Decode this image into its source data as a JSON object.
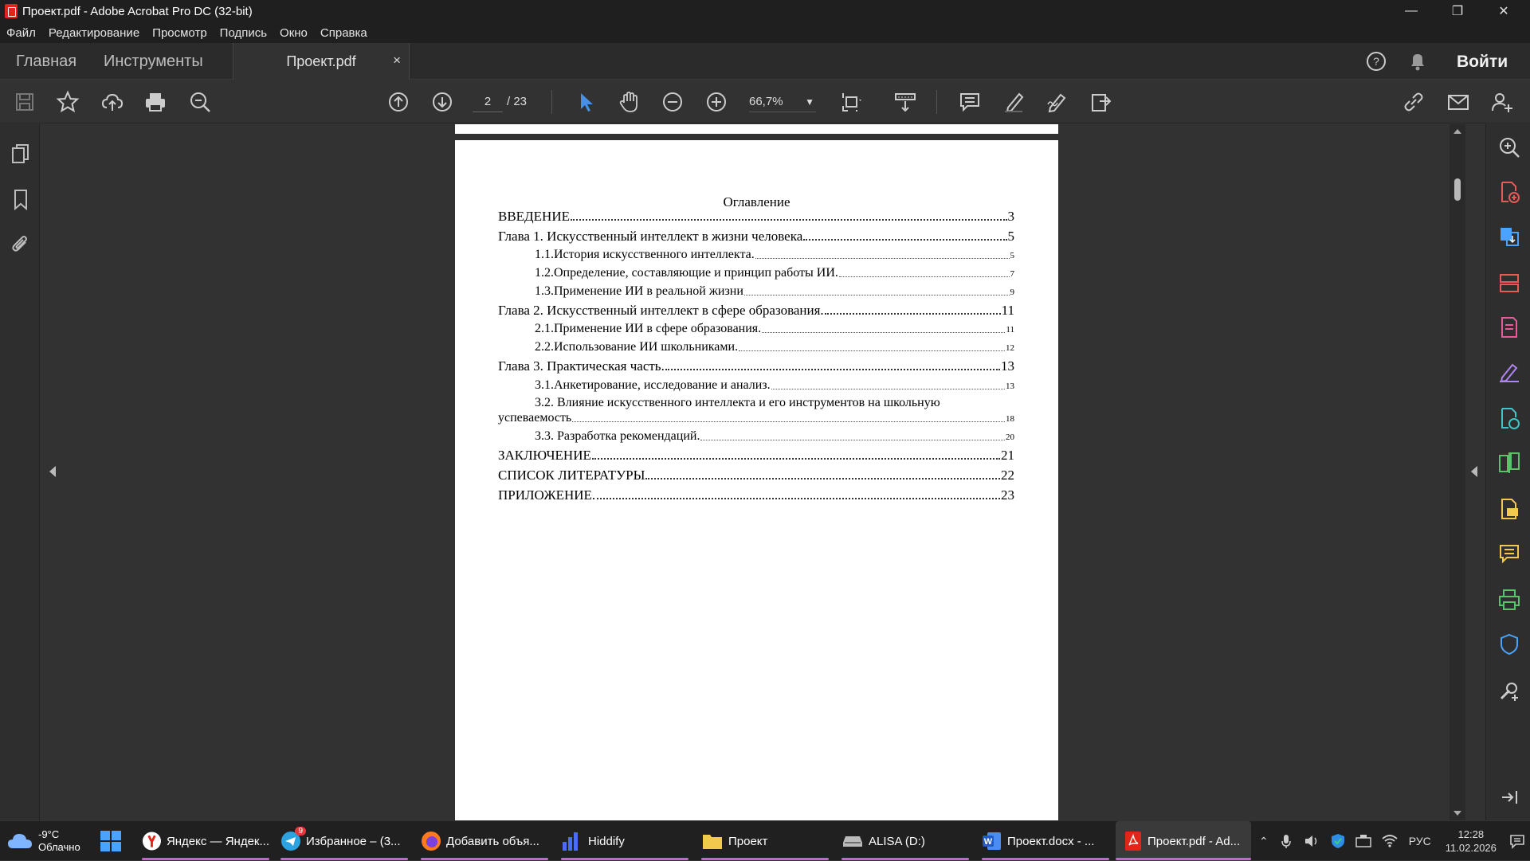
{
  "window": {
    "title": "Проект.pdf - Adobe Acrobat Pro DC (32-bit)"
  },
  "menu": {
    "items": [
      "Файл",
      "Редактирование",
      "Просмотр",
      "Подпись",
      "Окно",
      "Справка"
    ]
  },
  "tabs": {
    "home": "Главная",
    "tools": "Инструменты",
    "doc": "Проект.pdf",
    "close": "×",
    "login": "Войти"
  },
  "toolbar": {
    "page_current": "2",
    "page_total": "/ 23",
    "zoom": "66,7%"
  },
  "toc": {
    "title": "Оглавление",
    "rows": [
      {
        "text": "ВВЕДЕНИЕ",
        "page": "3"
      },
      {
        "text": "Глава 1. Искусственный интеллект в жизни человека",
        "page": "5"
      },
      {
        "text": "1.1.История искусственного интеллекта.",
        "page": "5"
      },
      {
        "text": "1.2.Определение, составляющие и принцип работы ИИ.",
        "page": "7"
      },
      {
        "text": "1.3.Применение ИИ в реальной жизни",
        "page": "9"
      },
      {
        "text": "Глава 2. Искусственный интеллект в сфере образования.",
        "page": "11"
      },
      {
        "text": "2.1.Применение ИИ в сфере образования.",
        "page": "11"
      },
      {
        "text": "2.2.Использование ИИ школьниками.",
        "page": "12"
      },
      {
        "text": "Глава 3. Практическая часть.",
        "page": "13"
      },
      {
        "text": "3.1.Анкетирование, исследование и анализ.",
        "page": "13"
      },
      {
        "text": "3.2. Влияние искусственного интеллекта и его инструментов на школьную",
        "page": ""
      },
      {
        "text": "успеваемость",
        "page": "18"
      },
      {
        "text": "3.3. Разработка рекомендаций.",
        "page": "20"
      },
      {
        "text": "ЗАКЛЮЧЕНИЕ",
        "page": "21"
      },
      {
        "text": "СПИСОК ЛИТЕРАТУРЫ",
        "page": "22"
      },
      {
        "text": "ПРИЛОЖЕНИЕ",
        "page": "23"
      }
    ]
  },
  "taskbar": {
    "weather_temp": "-9°C",
    "weather_desc": "Облачно",
    "apps": [
      {
        "label": "Яндекс — Яндек..."
      },
      {
        "label": "Избранное – (3..."
      },
      {
        "label": "Добавить объя..."
      },
      {
        "label": "Hiddify"
      },
      {
        "label": "Проект"
      },
      {
        "label": "ALISA (D:)"
      },
      {
        "label": "Проект.docx - ..."
      },
      {
        "label": "Проект.pdf - Ad..."
      }
    ],
    "badge": "9",
    "lang": "РУС",
    "time": "12:28",
    "date": "11.02.2026"
  },
  "colors": {
    "accent": "#4a90e2",
    "pdf_red": "#e1251b",
    "rail_purple": "#b084f5",
    "rail_blue": "#4aa3ff",
    "rail_green": "#59c36a",
    "rail_yellow": "#f2c94c"
  }
}
